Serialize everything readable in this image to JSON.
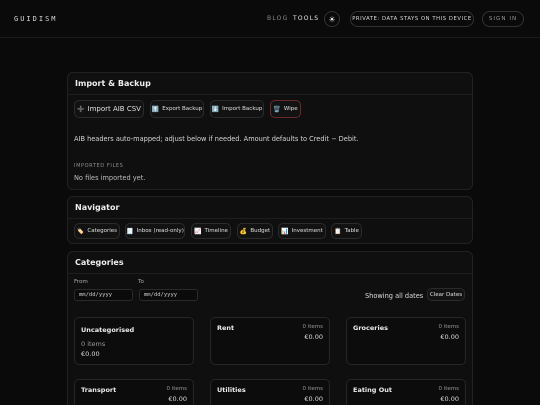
{
  "header": {
    "logo": "GUIDISM",
    "nav": {
      "blog": "BLOG",
      "tools": "TOOLS"
    },
    "theme_icon": "sun-icon",
    "privacy_badge": "PRIVATE: DATA STAYS ON THIS DEVICE",
    "signin": "SIGN IN"
  },
  "import_panel": {
    "title": "Import & Backup",
    "buttons": {
      "import_csv": {
        "icon": "➕",
        "label": "Import AIB CSV"
      },
      "export_backup": {
        "icon": "⬆️",
        "label": "Export Backup"
      },
      "import_backup": {
        "icon": "⬇️",
        "label": "Import Backup"
      },
      "wipe": {
        "icon": "🗑️",
        "label": "Wipe"
      }
    },
    "hint": "AIB headers auto-mapped; adjust below if needed. Amount defaults to Credit − Debit.",
    "imported_files_label": "IMPORTED FILES",
    "imported_files_empty": "No files imported yet."
  },
  "navigator": {
    "title": "Navigator",
    "items": [
      {
        "icon": "🏷️",
        "label": "Categories"
      },
      {
        "icon": "🧾",
        "label": "Inbox (read-only)"
      },
      {
        "icon": "📈",
        "label": "Timeline"
      },
      {
        "icon": "💰",
        "label": "Budget"
      },
      {
        "icon": "📊",
        "label": "Investment"
      },
      {
        "icon": "📋",
        "label": "Table"
      }
    ]
  },
  "categories_panel": {
    "title": "Categories",
    "from_label": "From",
    "to_label": "To",
    "from_value": "mm/dd/yyyy",
    "to_value": "mm/dd/yyyy",
    "showing": "Showing all dates",
    "clear_dates": "Clear Dates",
    "cards": [
      {
        "name": "Uncategorised",
        "items": "0 items",
        "amount": "€0.00"
      },
      {
        "name": "Rent",
        "items": "0 items",
        "amount": "€0.00"
      },
      {
        "name": "Groceries",
        "items": "0 items",
        "amount": "€0.00"
      },
      {
        "name": "Transport",
        "items": "0 items",
        "amount": "€0.00"
      },
      {
        "name": "Utilities",
        "items": "0 items",
        "amount": "€0.00"
      },
      {
        "name": "Eating Out",
        "items": "0 items",
        "amount": "€0.00"
      }
    ]
  }
}
